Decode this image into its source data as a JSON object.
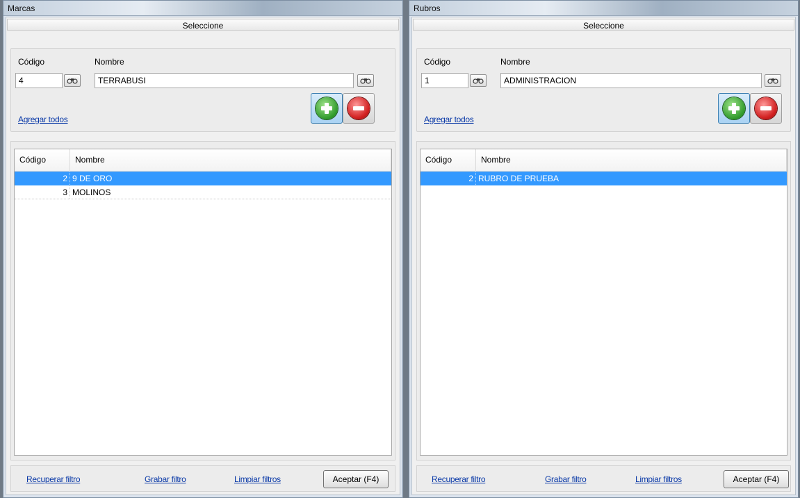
{
  "windows": [
    {
      "title": "Marcas",
      "section_header": "Seleccione",
      "code_label": "Código",
      "name_label": "Nombre",
      "code_value": "4",
      "name_value": "TERRABUSI",
      "add_all_link": "Agregar todos",
      "columns": [
        "Código",
        "Nombre"
      ],
      "rows": [
        {
          "code": "2",
          "name": "9 DE ORO",
          "selected": true
        },
        {
          "code": "3",
          "name": "MOLINOS",
          "selected": false
        }
      ],
      "footer": {
        "recover": "Recuperar filtro",
        "save": "Grabar filtro",
        "clear": "Limpiar filtros",
        "accept": "Aceptar (F4)"
      }
    },
    {
      "title": "Rubros",
      "section_header": "Seleccione",
      "code_label": "Código",
      "name_label": "Nombre",
      "code_value": "1",
      "name_value": "ADMINISTRACION",
      "add_all_link": "Agregar todos",
      "columns": [
        "Código",
        "Nombre"
      ],
      "rows": [
        {
          "code": "2",
          "name": "RUBRO DE PRUEBA",
          "selected": true
        }
      ],
      "footer": {
        "recover": "Recuperar filtro",
        "save": "Grabar filtro",
        "clear": "Limpiar filtros",
        "accept": "Aceptar (F4)"
      }
    }
  ],
  "icons": {
    "search": "binoculars-icon",
    "add": "green-plus-icon",
    "remove": "red-minus-icon"
  },
  "colors": {
    "selection": "#3399ff",
    "link": "#0b3aa8",
    "add_button": "#2f9a2a",
    "remove_button": "#d22020"
  }
}
